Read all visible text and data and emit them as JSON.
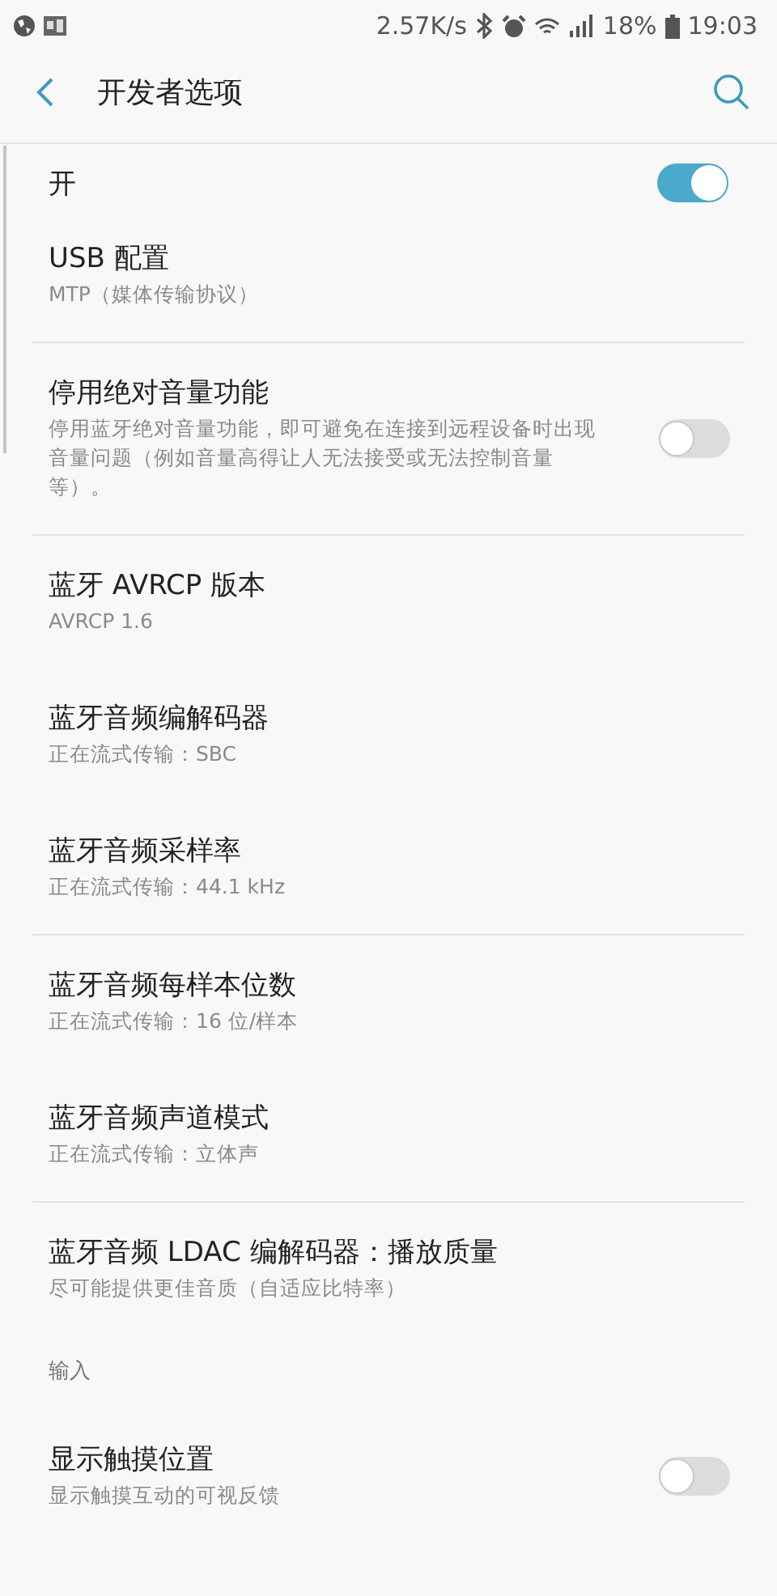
{
  "status_bar": {
    "speed": "2.57K/s",
    "battery": "18%",
    "time": "19:03"
  },
  "app_bar": {
    "title": "开发者选项"
  },
  "master_switch": {
    "label": "开",
    "on": true
  },
  "items": [
    {
      "kind": "setting",
      "title": "USB 配置",
      "subtitle": "MTP（媒体传输协议）",
      "divider": true
    },
    {
      "kind": "switch",
      "title": "停用绝对音量功能",
      "subtitle": "停用蓝牙绝对音量功能，即可避免在连接到远程设备时出现音量问题（例如音量高得让人无法接受或无法控制音量等）。",
      "on": false,
      "divider": true
    },
    {
      "kind": "setting",
      "title": "蓝牙 AVRCP 版本",
      "subtitle": "AVRCP 1.6",
      "divider": false
    },
    {
      "kind": "setting",
      "title": "蓝牙音频编解码器",
      "subtitle": "正在流式传输：SBC",
      "divider": false
    },
    {
      "kind": "setting",
      "title": "蓝牙音频采样率",
      "subtitle": "正在流式传输：44.1 kHz",
      "divider": true
    },
    {
      "kind": "setting",
      "title": "蓝牙音频每样本位数",
      "subtitle": "正在流式传输：16 位/样本",
      "divider": false
    },
    {
      "kind": "setting",
      "title": "蓝牙音频声道模式",
      "subtitle": "正在流式传输：立体声",
      "divider": true
    },
    {
      "kind": "setting",
      "title": "蓝牙音频 LDAC 编解码器：播放质量",
      "subtitle": "尽可能提供更佳音质（自适应比特率）",
      "divider": false
    },
    {
      "kind": "header",
      "title": "输入"
    },
    {
      "kind": "switch",
      "title": "显示触摸位置",
      "subtitle": "显示触摸互动的可视反馈",
      "on": false,
      "divider": false
    }
  ]
}
